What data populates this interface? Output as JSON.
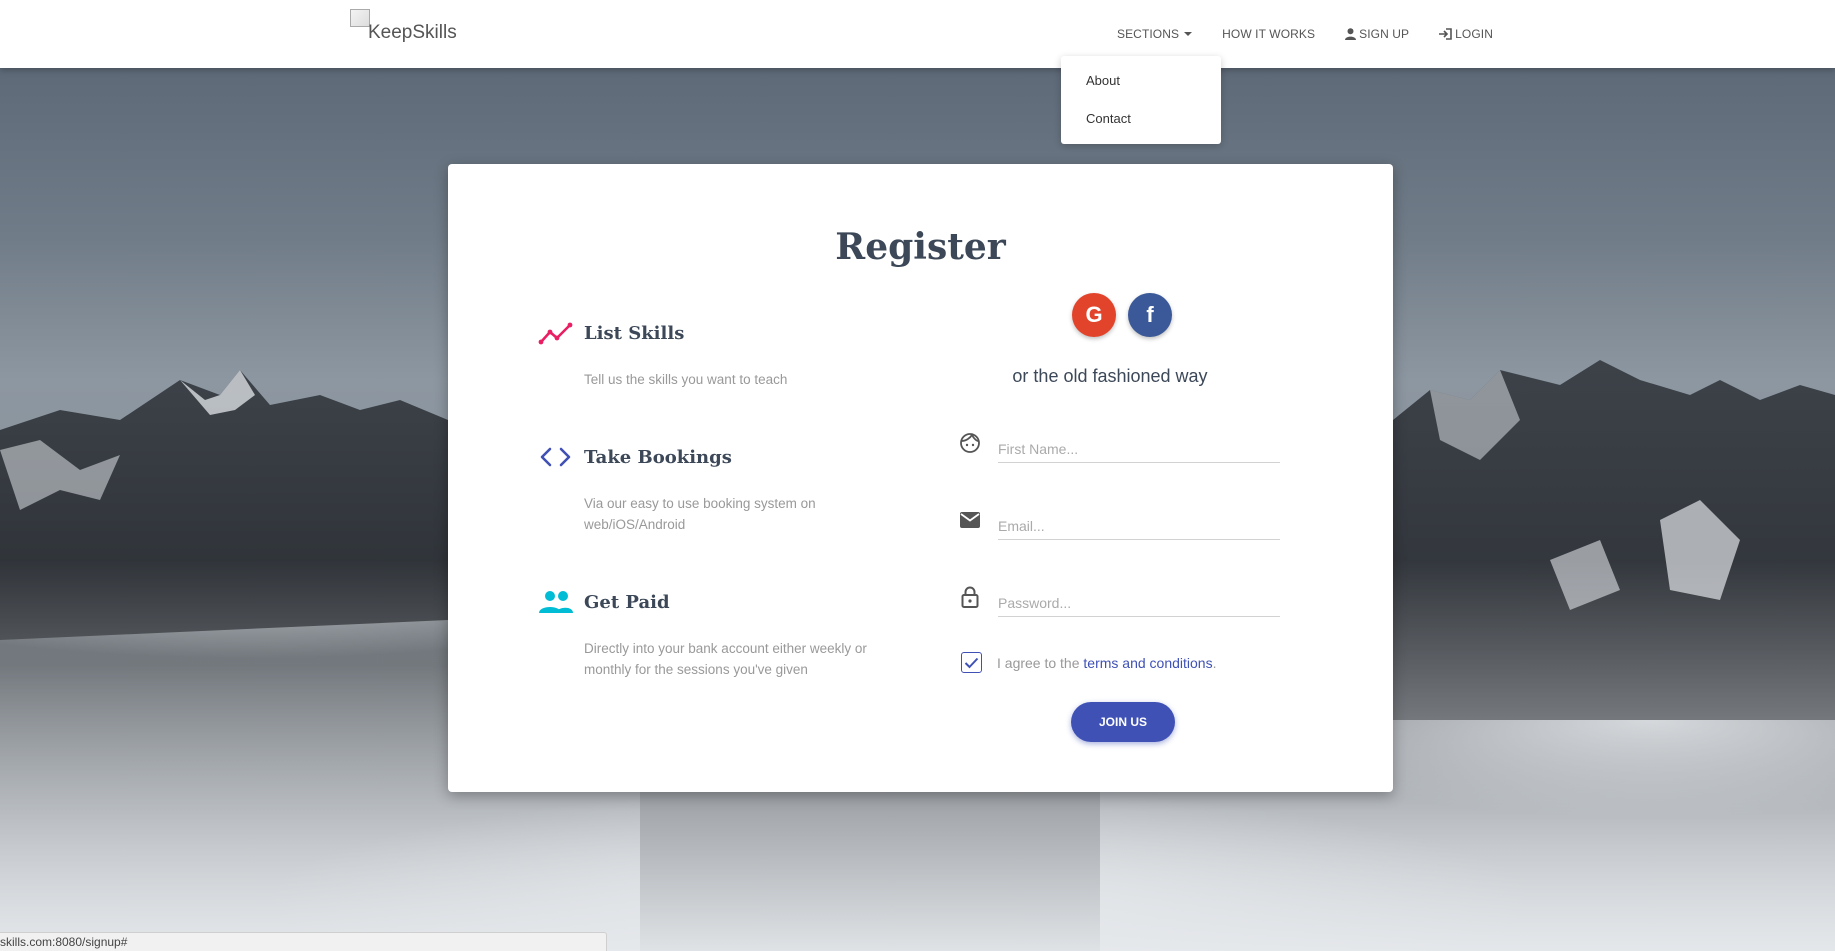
{
  "brand": {
    "name": "KeepSkills"
  },
  "nav": {
    "sections": "SECTIONS",
    "how_it_works": "HOW IT WORKS",
    "sign_up": "SIGN UP",
    "login": "LOGIN"
  },
  "dropdown": {
    "items": [
      "About",
      "Contact"
    ]
  },
  "register": {
    "title": "Register",
    "features": [
      {
        "title": "List Skills",
        "desc": "Tell us the skills you want to teach",
        "icon": "trending-icon",
        "color": "#e91e63"
      },
      {
        "title": "Take Bookings",
        "desc": "Via our easy to use booking system on web/iOS/Android",
        "icon": "code-icon",
        "color": "#3f51b5"
      },
      {
        "title": "Get Paid",
        "desc": "Directly into your bank account either weekly or monthly for the sessions you've given",
        "icon": "people-icon",
        "color": "#00bcd4"
      }
    ],
    "social": {
      "google": "G",
      "facebook": "f"
    },
    "old_way": "or the old fashioned way",
    "first_name_placeholder": "First Name...",
    "email_placeholder": "Email...",
    "password_placeholder": "Password...",
    "agree_text": "I agree to the ",
    "agree_link": "terms and conditions",
    "agree_end": ".",
    "agree_checked": true,
    "join_label": "Join Us"
  },
  "status": {
    "url": "skills.com:8080/signup#"
  },
  "colors": {
    "primary": "#3f51b5",
    "google": "#e2432b",
    "facebook": "#3b5998"
  }
}
